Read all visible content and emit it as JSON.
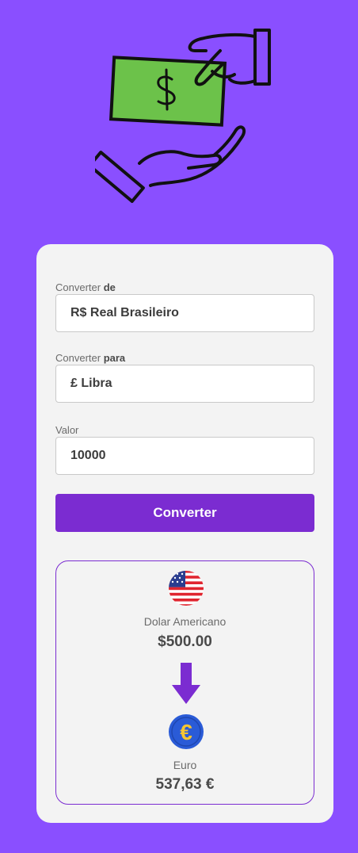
{
  "form": {
    "from_label_prefix": "Converter ",
    "from_label_bold": "de",
    "from_value": "R$ Real Brasileiro",
    "to_label_prefix": "Converter ",
    "to_label_bold": "para",
    "to_value": "£ Libra",
    "amount_label": "Valor",
    "amount_value": "10000",
    "convert_button": "Converter"
  },
  "result": {
    "source_currency_name": "Dolar Americano",
    "source_amount": "$500.00",
    "target_currency_name": "Euro",
    "target_amount": "537,63 €",
    "source_icon": "us-flag-icon",
    "target_icon": "euro-coin-icon",
    "arrow_icon": "arrow-down-icon"
  },
  "colors": {
    "background": "#8a4fff",
    "accent": "#7b2cd1",
    "money_green": "#6cc24a"
  }
}
